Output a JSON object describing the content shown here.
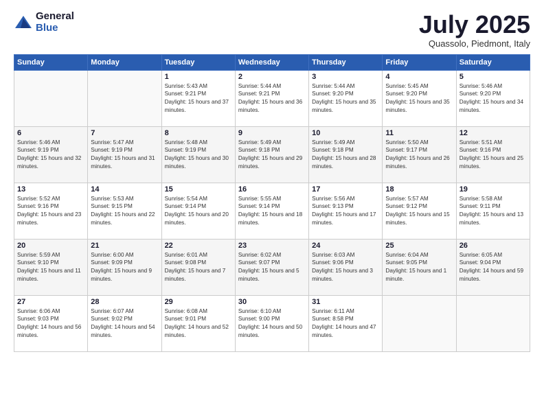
{
  "logo": {
    "general": "General",
    "blue": "Blue"
  },
  "header": {
    "month": "July 2025",
    "location": "Quassolo, Piedmont, Italy"
  },
  "weekdays": [
    "Sunday",
    "Monday",
    "Tuesday",
    "Wednesday",
    "Thursday",
    "Friday",
    "Saturday"
  ],
  "weeks": [
    [
      {
        "day": "",
        "info": ""
      },
      {
        "day": "",
        "info": ""
      },
      {
        "day": "1",
        "info": "Sunrise: 5:43 AM\nSunset: 9:21 PM\nDaylight: 15 hours and 37 minutes."
      },
      {
        "day": "2",
        "info": "Sunrise: 5:44 AM\nSunset: 9:21 PM\nDaylight: 15 hours and 36 minutes."
      },
      {
        "day": "3",
        "info": "Sunrise: 5:44 AM\nSunset: 9:20 PM\nDaylight: 15 hours and 35 minutes."
      },
      {
        "day": "4",
        "info": "Sunrise: 5:45 AM\nSunset: 9:20 PM\nDaylight: 15 hours and 35 minutes."
      },
      {
        "day": "5",
        "info": "Sunrise: 5:46 AM\nSunset: 9:20 PM\nDaylight: 15 hours and 34 minutes."
      }
    ],
    [
      {
        "day": "6",
        "info": "Sunrise: 5:46 AM\nSunset: 9:19 PM\nDaylight: 15 hours and 32 minutes."
      },
      {
        "day": "7",
        "info": "Sunrise: 5:47 AM\nSunset: 9:19 PM\nDaylight: 15 hours and 31 minutes."
      },
      {
        "day": "8",
        "info": "Sunrise: 5:48 AM\nSunset: 9:19 PM\nDaylight: 15 hours and 30 minutes."
      },
      {
        "day": "9",
        "info": "Sunrise: 5:49 AM\nSunset: 9:18 PM\nDaylight: 15 hours and 29 minutes."
      },
      {
        "day": "10",
        "info": "Sunrise: 5:49 AM\nSunset: 9:18 PM\nDaylight: 15 hours and 28 minutes."
      },
      {
        "day": "11",
        "info": "Sunrise: 5:50 AM\nSunset: 9:17 PM\nDaylight: 15 hours and 26 minutes."
      },
      {
        "day": "12",
        "info": "Sunrise: 5:51 AM\nSunset: 9:16 PM\nDaylight: 15 hours and 25 minutes."
      }
    ],
    [
      {
        "day": "13",
        "info": "Sunrise: 5:52 AM\nSunset: 9:16 PM\nDaylight: 15 hours and 23 minutes."
      },
      {
        "day": "14",
        "info": "Sunrise: 5:53 AM\nSunset: 9:15 PM\nDaylight: 15 hours and 22 minutes."
      },
      {
        "day": "15",
        "info": "Sunrise: 5:54 AM\nSunset: 9:14 PM\nDaylight: 15 hours and 20 minutes."
      },
      {
        "day": "16",
        "info": "Sunrise: 5:55 AM\nSunset: 9:14 PM\nDaylight: 15 hours and 18 minutes."
      },
      {
        "day": "17",
        "info": "Sunrise: 5:56 AM\nSunset: 9:13 PM\nDaylight: 15 hours and 17 minutes."
      },
      {
        "day": "18",
        "info": "Sunrise: 5:57 AM\nSunset: 9:12 PM\nDaylight: 15 hours and 15 minutes."
      },
      {
        "day": "19",
        "info": "Sunrise: 5:58 AM\nSunset: 9:11 PM\nDaylight: 15 hours and 13 minutes."
      }
    ],
    [
      {
        "day": "20",
        "info": "Sunrise: 5:59 AM\nSunset: 9:10 PM\nDaylight: 15 hours and 11 minutes."
      },
      {
        "day": "21",
        "info": "Sunrise: 6:00 AM\nSunset: 9:09 PM\nDaylight: 15 hours and 9 minutes."
      },
      {
        "day": "22",
        "info": "Sunrise: 6:01 AM\nSunset: 9:08 PM\nDaylight: 15 hours and 7 minutes."
      },
      {
        "day": "23",
        "info": "Sunrise: 6:02 AM\nSunset: 9:07 PM\nDaylight: 15 hours and 5 minutes."
      },
      {
        "day": "24",
        "info": "Sunrise: 6:03 AM\nSunset: 9:06 PM\nDaylight: 15 hours and 3 minutes."
      },
      {
        "day": "25",
        "info": "Sunrise: 6:04 AM\nSunset: 9:05 PM\nDaylight: 15 hours and 1 minute."
      },
      {
        "day": "26",
        "info": "Sunrise: 6:05 AM\nSunset: 9:04 PM\nDaylight: 14 hours and 59 minutes."
      }
    ],
    [
      {
        "day": "27",
        "info": "Sunrise: 6:06 AM\nSunset: 9:03 PM\nDaylight: 14 hours and 56 minutes."
      },
      {
        "day": "28",
        "info": "Sunrise: 6:07 AM\nSunset: 9:02 PM\nDaylight: 14 hours and 54 minutes."
      },
      {
        "day": "29",
        "info": "Sunrise: 6:08 AM\nSunset: 9:01 PM\nDaylight: 14 hours and 52 minutes."
      },
      {
        "day": "30",
        "info": "Sunrise: 6:10 AM\nSunset: 9:00 PM\nDaylight: 14 hours and 50 minutes."
      },
      {
        "day": "31",
        "info": "Sunrise: 6:11 AM\nSunset: 8:58 PM\nDaylight: 14 hours and 47 minutes."
      },
      {
        "day": "",
        "info": ""
      },
      {
        "day": "",
        "info": ""
      }
    ]
  ]
}
